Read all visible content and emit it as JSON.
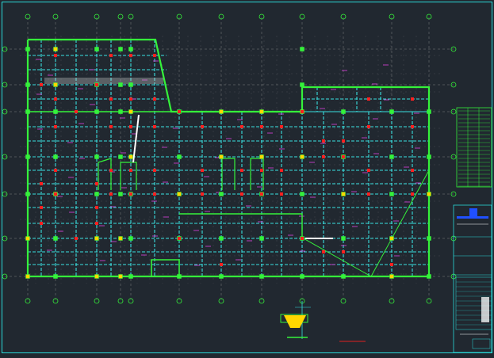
{
  "drawing": {
    "background": "#212830",
    "colors": {
      "frame": "#2ad7d7",
      "wall": "#35f23a",
      "beam": "#39e0e0",
      "grid": "#c8c8c8",
      "column": "#ff2020",
      "column_yellow": "#ffd700",
      "accent_magenta": "#e040e0",
      "white": "#ffffff",
      "title_blue": "#2050ff",
      "red_mark": "#e02020"
    },
    "icons": {
      "axis_bubble": "axis-bubble-icon",
      "section_detail": "section-detail-icon"
    }
  }
}
